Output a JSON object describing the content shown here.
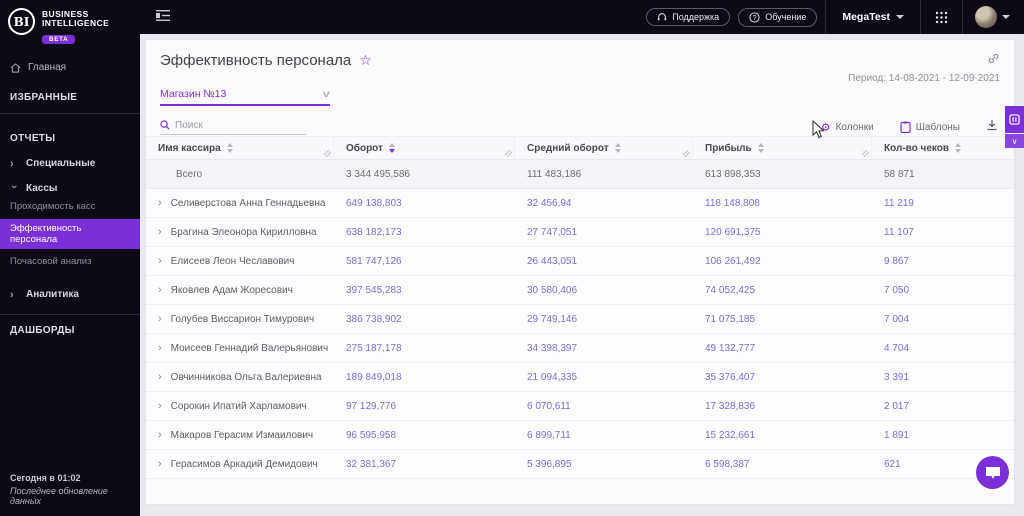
{
  "brand": {
    "logo_text": "BI",
    "name_line1": "BUSINESS",
    "name_line2": "INTELLIGENCE",
    "beta_label": "BETA"
  },
  "topbar": {
    "support_label": "Поддержка",
    "training_label": "Обучение",
    "org_label": "MegaTest"
  },
  "sidebar": {
    "home_label": "Главная",
    "favorites_label": "ИЗБРАННЫЕ",
    "reports_label": "ОТЧЕТЫ",
    "special_label": "Специальные",
    "kassy_label": "Кассы",
    "kassy_items": [
      "Проходимость касс",
      "Эффективность персонала",
      "Почасовой анализ"
    ],
    "active_item": "Эффективность персонала",
    "analytics_label": "Аналитика",
    "dashboards_label": "ДАШБОРДЫ",
    "updated_time": "Сегодня в 01:02",
    "updated_caption": "Последнее обновление данных"
  },
  "page": {
    "title": "Эффективность персонала",
    "period_label": "Период: 14-08-2021 - 12-09-2021",
    "store_filter": "Магазин №13",
    "search_placeholder": "Поиск",
    "columns_button": "Колонки",
    "templates_button": "Шаблоны"
  },
  "icons": {
    "star": "☆",
    "gear": "⚙",
    "chevron_right": "›",
    "chevron_down_small": "∨"
  },
  "table": {
    "headers": [
      "Имя кассира",
      "Оборот",
      "Средний оборот",
      "Прибыль",
      "Кол-во чеков"
    ],
    "sorted_by": "Оборот",
    "totals": {
      "label": "Всего",
      "turnover": "3 344 495,586",
      "avg_turnover": "111 483,186",
      "profit": "613 898,353",
      "receipts": "58 871"
    },
    "rows": [
      {
        "name": "Селиверстова Анна Геннадьевна",
        "turnover": "649 138,803",
        "avg_turnover": "32 456,94",
        "profit": "118 148,808",
        "receipts": "11 219"
      },
      {
        "name": "Брагина Элеонора Кирилловна",
        "turnover": "638 182,173",
        "avg_turnover": "27 747,051",
        "profit": "120 691,375",
        "receipts": "11 107"
      },
      {
        "name": "Елисеев Леон Чеславович",
        "turnover": "581 747,126",
        "avg_turnover": "26 443,051",
        "profit": "106 261,492",
        "receipts": "9 867"
      },
      {
        "name": "Яковлев Адам Жоресович",
        "turnover": "397 545,283",
        "avg_turnover": "30 580,406",
        "profit": "74 052,425",
        "receipts": "7 050"
      },
      {
        "name": "Голубев Виссарион Тимурович",
        "turnover": "386 738,902",
        "avg_turnover": "29 749,146",
        "profit": "71 075,185",
        "receipts": "7 004"
      },
      {
        "name": "Моисеев Геннадий Валерьянович",
        "turnover": "275 187,178",
        "avg_turnover": "34 398,397",
        "profit": "49 132,777",
        "receipts": "4 704"
      },
      {
        "name": "Овчинникова Ольга Валериевна",
        "turnover": "189 849,018",
        "avg_turnover": "21 094,335",
        "profit": "35 376,407",
        "receipts": "3 391"
      },
      {
        "name": "Сорокин Ипатий Харламович",
        "turnover": "97 129,776",
        "avg_turnover": "6 070,611",
        "profit": "17 328,836",
        "receipts": "2 017"
      },
      {
        "name": "Макаров Герасим Измаилович",
        "turnover": "96 595,958",
        "avg_turnover": "6 899,711",
        "profit": "15 232,661",
        "receipts": "1 891"
      },
      {
        "name": "Герасимов Аркадий Демидович",
        "turnover": "32 381,367",
        "avg_turnover": "5 396,895",
        "profit": "6 598,387",
        "receipts": "621"
      }
    ]
  },
  "colors": {
    "accent": "#7b2fd6",
    "number_text": "#7d6ed3",
    "dark_bg": "#0d0a16"
  }
}
